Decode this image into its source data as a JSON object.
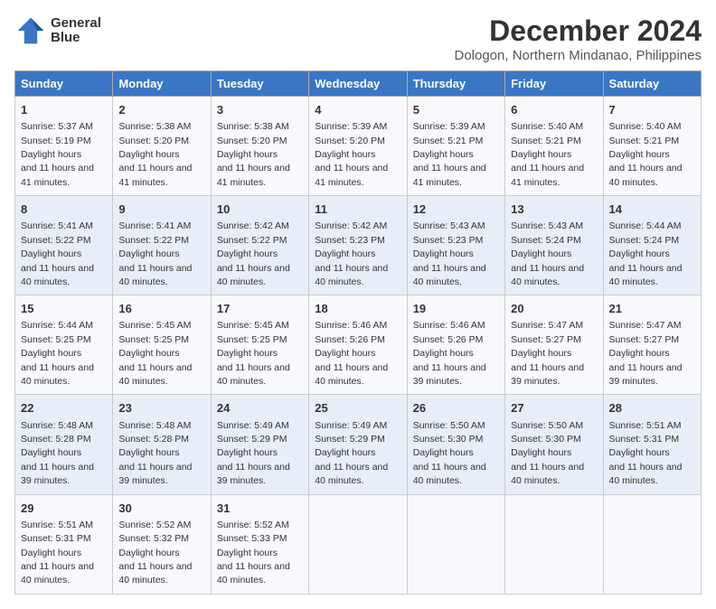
{
  "logo": {
    "line1": "General",
    "line2": "Blue"
  },
  "title": "December 2024",
  "subtitle": "Dologon, Northern Mindanao, Philippines",
  "columns": [
    "Sunday",
    "Monday",
    "Tuesday",
    "Wednesday",
    "Thursday",
    "Friday",
    "Saturday"
  ],
  "weeks": [
    [
      {
        "day": "1",
        "sunrise": "5:37 AM",
        "sunset": "5:19 PM",
        "daylight": "11 hours and 41 minutes."
      },
      {
        "day": "2",
        "sunrise": "5:38 AM",
        "sunset": "5:20 PM",
        "daylight": "11 hours and 41 minutes."
      },
      {
        "day": "3",
        "sunrise": "5:38 AM",
        "sunset": "5:20 PM",
        "daylight": "11 hours and 41 minutes."
      },
      {
        "day": "4",
        "sunrise": "5:39 AM",
        "sunset": "5:20 PM",
        "daylight": "11 hours and 41 minutes."
      },
      {
        "day": "5",
        "sunrise": "5:39 AM",
        "sunset": "5:21 PM",
        "daylight": "11 hours and 41 minutes."
      },
      {
        "day": "6",
        "sunrise": "5:40 AM",
        "sunset": "5:21 PM",
        "daylight": "11 hours and 41 minutes."
      },
      {
        "day": "7",
        "sunrise": "5:40 AM",
        "sunset": "5:21 PM",
        "daylight": "11 hours and 40 minutes."
      }
    ],
    [
      {
        "day": "8",
        "sunrise": "5:41 AM",
        "sunset": "5:22 PM",
        "daylight": "11 hours and 40 minutes."
      },
      {
        "day": "9",
        "sunrise": "5:41 AM",
        "sunset": "5:22 PM",
        "daylight": "11 hours and 40 minutes."
      },
      {
        "day": "10",
        "sunrise": "5:42 AM",
        "sunset": "5:22 PM",
        "daylight": "11 hours and 40 minutes."
      },
      {
        "day": "11",
        "sunrise": "5:42 AM",
        "sunset": "5:23 PM",
        "daylight": "11 hours and 40 minutes."
      },
      {
        "day": "12",
        "sunrise": "5:43 AM",
        "sunset": "5:23 PM",
        "daylight": "11 hours and 40 minutes."
      },
      {
        "day": "13",
        "sunrise": "5:43 AM",
        "sunset": "5:24 PM",
        "daylight": "11 hours and 40 minutes."
      },
      {
        "day": "14",
        "sunrise": "5:44 AM",
        "sunset": "5:24 PM",
        "daylight": "11 hours and 40 minutes."
      }
    ],
    [
      {
        "day": "15",
        "sunrise": "5:44 AM",
        "sunset": "5:25 PM",
        "daylight": "11 hours and 40 minutes."
      },
      {
        "day": "16",
        "sunrise": "5:45 AM",
        "sunset": "5:25 PM",
        "daylight": "11 hours and 40 minutes."
      },
      {
        "day": "17",
        "sunrise": "5:45 AM",
        "sunset": "5:25 PM",
        "daylight": "11 hours and 40 minutes."
      },
      {
        "day": "18",
        "sunrise": "5:46 AM",
        "sunset": "5:26 PM",
        "daylight": "11 hours and 40 minutes."
      },
      {
        "day": "19",
        "sunrise": "5:46 AM",
        "sunset": "5:26 PM",
        "daylight": "11 hours and 39 minutes."
      },
      {
        "day": "20",
        "sunrise": "5:47 AM",
        "sunset": "5:27 PM",
        "daylight": "11 hours and 39 minutes."
      },
      {
        "day": "21",
        "sunrise": "5:47 AM",
        "sunset": "5:27 PM",
        "daylight": "11 hours and 39 minutes."
      }
    ],
    [
      {
        "day": "22",
        "sunrise": "5:48 AM",
        "sunset": "5:28 PM",
        "daylight": "11 hours and 39 minutes."
      },
      {
        "day": "23",
        "sunrise": "5:48 AM",
        "sunset": "5:28 PM",
        "daylight": "11 hours and 39 minutes."
      },
      {
        "day": "24",
        "sunrise": "5:49 AM",
        "sunset": "5:29 PM",
        "daylight": "11 hours and 39 minutes."
      },
      {
        "day": "25",
        "sunrise": "5:49 AM",
        "sunset": "5:29 PM",
        "daylight": "11 hours and 40 minutes."
      },
      {
        "day": "26",
        "sunrise": "5:50 AM",
        "sunset": "5:30 PM",
        "daylight": "11 hours and 40 minutes."
      },
      {
        "day": "27",
        "sunrise": "5:50 AM",
        "sunset": "5:30 PM",
        "daylight": "11 hours and 40 minutes."
      },
      {
        "day": "28",
        "sunrise": "5:51 AM",
        "sunset": "5:31 PM",
        "daylight": "11 hours and 40 minutes."
      }
    ],
    [
      {
        "day": "29",
        "sunrise": "5:51 AM",
        "sunset": "5:31 PM",
        "daylight": "11 hours and 40 minutes."
      },
      {
        "day": "30",
        "sunrise": "5:52 AM",
        "sunset": "5:32 PM",
        "daylight": "11 hours and 40 minutes."
      },
      {
        "day": "31",
        "sunrise": "5:52 AM",
        "sunset": "5:33 PM",
        "daylight": "11 hours and 40 minutes."
      },
      null,
      null,
      null,
      null
    ]
  ]
}
